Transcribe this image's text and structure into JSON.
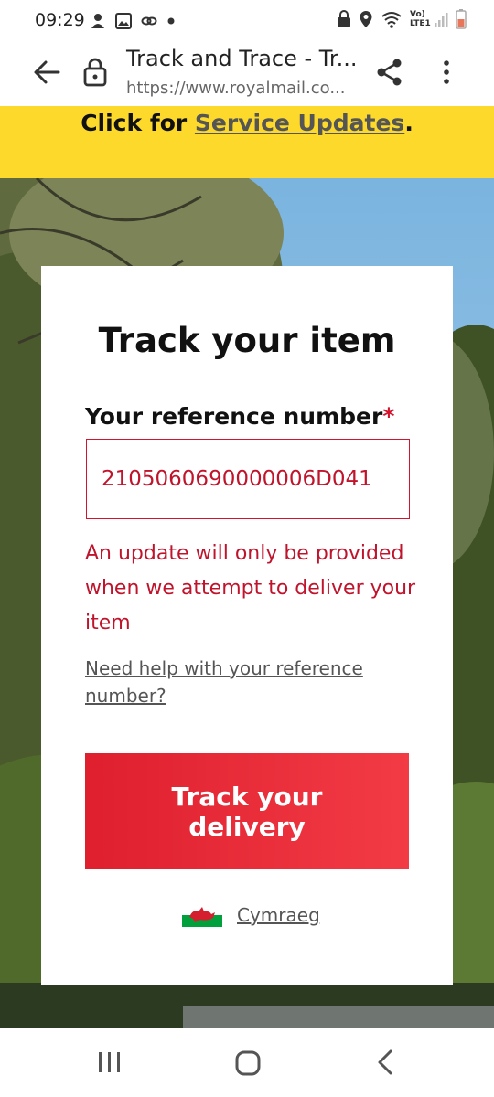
{
  "status_bar": {
    "time": "09:29",
    "left_icons": [
      "notification-icon",
      "gallery-icon",
      "link-icon",
      "dot-icon"
    ],
    "right_icons": [
      "lock-icon",
      "location-icon",
      "wifi-icon",
      "lte-signal-icon",
      "battery-icon"
    ],
    "network_label": "Vo) LTE1"
  },
  "browser": {
    "page_title": "Track and Trace - Tr...",
    "url": "https://www.royalmail.co..."
  },
  "banner": {
    "prefix": "Click for ",
    "link": "Service Updates",
    "suffix": ".",
    "color": "#fcd92a"
  },
  "form": {
    "title": "Track your item",
    "ref_label": "Your reference number",
    "required_marker": "*",
    "ref_value": "2105060690000006D041",
    "error": "An update will only be provided when we attempt to deliver your item",
    "help_link": "Need help with your reference number?",
    "submit_line1": "Track your",
    "submit_line2": "delivery",
    "language_link": "Cymraeg"
  },
  "colors": {
    "accent_red": "#df1f2e",
    "error_red": "#c0142c"
  }
}
